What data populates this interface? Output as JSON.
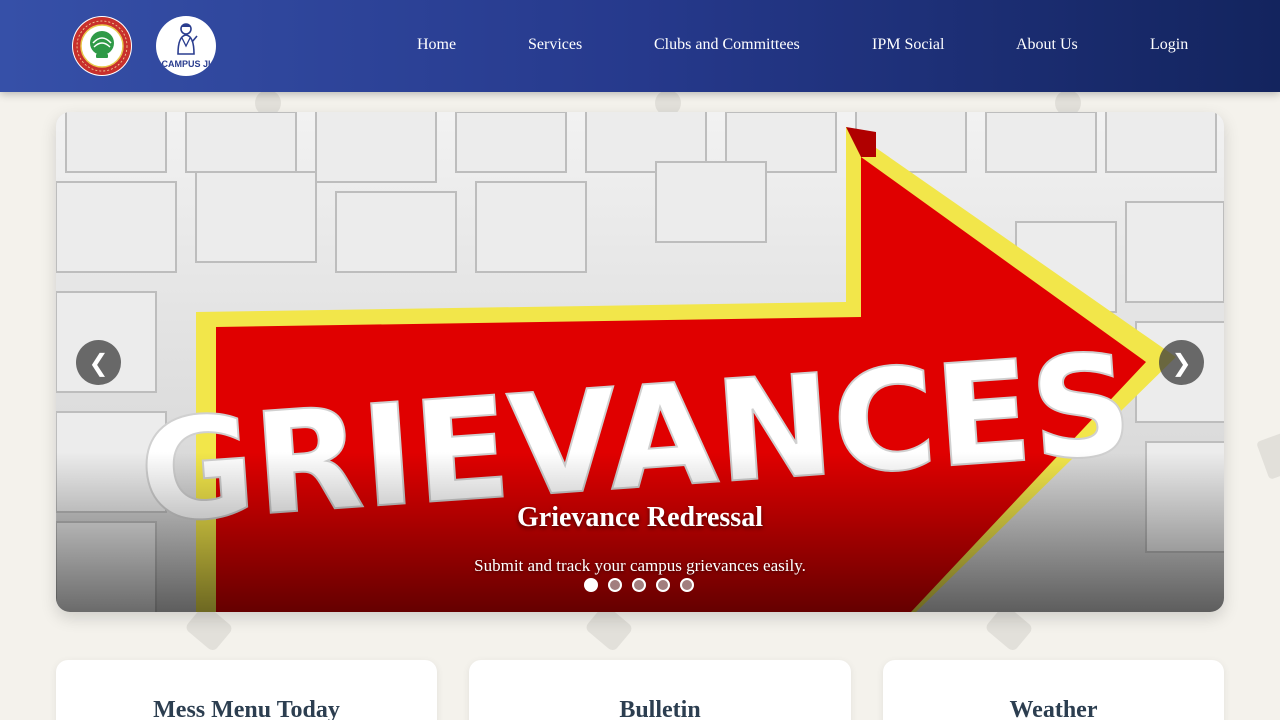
{
  "nav": {
    "logos": [
      {
        "name": "iim-logo",
        "alt": "Indian Institute of Management Rohtak"
      },
      {
        "name": "campus-ji-logo",
        "text": "CAMPUS JI"
      }
    ],
    "links": [
      "Home",
      "Services",
      "Clubs and Committees",
      "IPM Social",
      "About Us",
      "Login"
    ]
  },
  "carousel": {
    "slide_image_text": "GRIEVANCES",
    "title": "Grievance Redressal",
    "caption": "Submit and track your campus grievances easily.",
    "prev_glyph": "❮",
    "next_glyph": "❯",
    "slide_count": 5,
    "active_index": 0
  },
  "cards": [
    {
      "title": "Mess Menu Today"
    },
    {
      "title": "Bulletin"
    },
    {
      "title": "Weather"
    }
  ],
  "colors": {
    "nav_start": "#3650a8",
    "nav_end": "#13245e",
    "arrow_red": "#e00000",
    "arrow_border": "#f2e64a",
    "card_title": "#2c3e50",
    "page_bg": "#f4f2ec"
  }
}
